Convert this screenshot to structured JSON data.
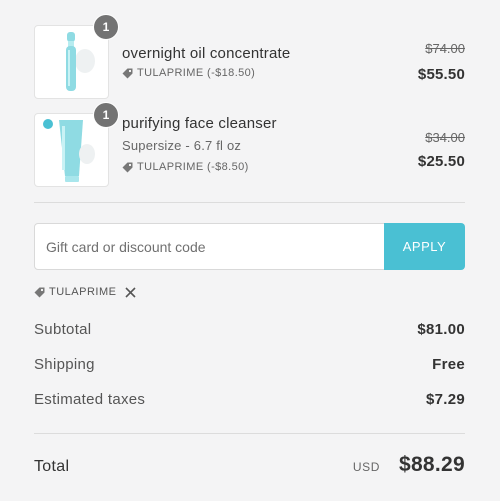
{
  "cart": {
    "items": [
      {
        "quantity": "1",
        "name": "overnight oil concentrate",
        "variant": "",
        "discount": "TULAPRIME (-$18.50)",
        "original_price": "$74.00",
        "price": "$55.50",
        "image_icon": "serum-bottle-icon"
      },
      {
        "quantity": "1",
        "name": "purifying face cleanser",
        "variant": "Supersize - 6.7 fl oz",
        "discount": "TULAPRIME (-$8.50)",
        "original_price": "$34.00",
        "price": "$25.50",
        "image_icon": "cleanser-tube-icon"
      }
    ]
  },
  "discount": {
    "placeholder": "Gift card or discount code",
    "value": "",
    "apply_label": "APPLY",
    "applied_code": "TULAPRIME"
  },
  "summary": {
    "subtotal_label": "Subtotal",
    "subtotal_value": "$81.00",
    "shipping_label": "Shipping",
    "shipping_value": "Free",
    "taxes_label": "Estimated taxes",
    "taxes_value": "$7.29",
    "total_label": "Total",
    "currency": "USD",
    "total_value": "$88.29"
  },
  "colors": {
    "accent": "#4ac0d3",
    "product_teal": "#8fdbe3",
    "badge": "#737373",
    "background": "#f4f4f5"
  }
}
